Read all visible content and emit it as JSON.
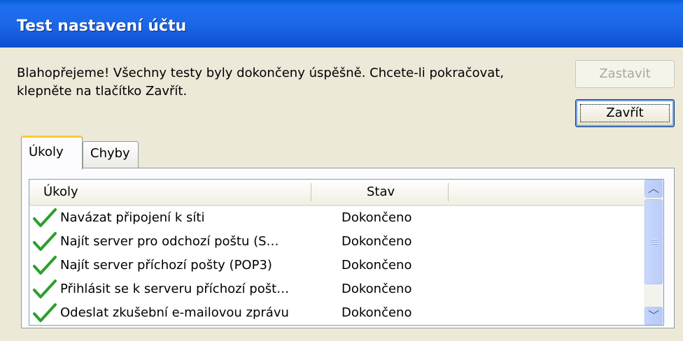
{
  "window": {
    "title": "Test nastavení účtu"
  },
  "message": {
    "line1": "Blahopřejeme! Všechny testy byly dokončeny úspěšně. Chcete-li pokračovat,",
    "line2": "klepněte na tlačítko Zavřít."
  },
  "buttons": {
    "stop_label": "Zastavit",
    "close_label": "Zavřít"
  },
  "tabs": [
    {
      "label": "Úkoly"
    },
    {
      "label": "Chyby"
    }
  ],
  "table": {
    "columns": [
      "Úkoly",
      "Stav"
    ],
    "rows": [
      {
        "task": "Navázat připojení k síti",
        "status": "Dokončeno"
      },
      {
        "task": "Najít server pro odchozí poštu (S…",
        "status": "Dokončeno"
      },
      {
        "task": "Najít server příchozí pošty (POP3)",
        "status": "Dokončeno"
      },
      {
        "task": "Přihlásit se k serveru příchozí pošt…",
        "status": "Dokončeno"
      },
      {
        "task": "Odeslat zkušební e-mailovou zprávu",
        "status": "Dokončeno"
      }
    ],
    "row_icon": "green-checkmark-icon"
  },
  "colors": {
    "titlebar": "#0a5fd8",
    "check": "#2e9e2e",
    "tab_highlight": "#ffc83c"
  }
}
